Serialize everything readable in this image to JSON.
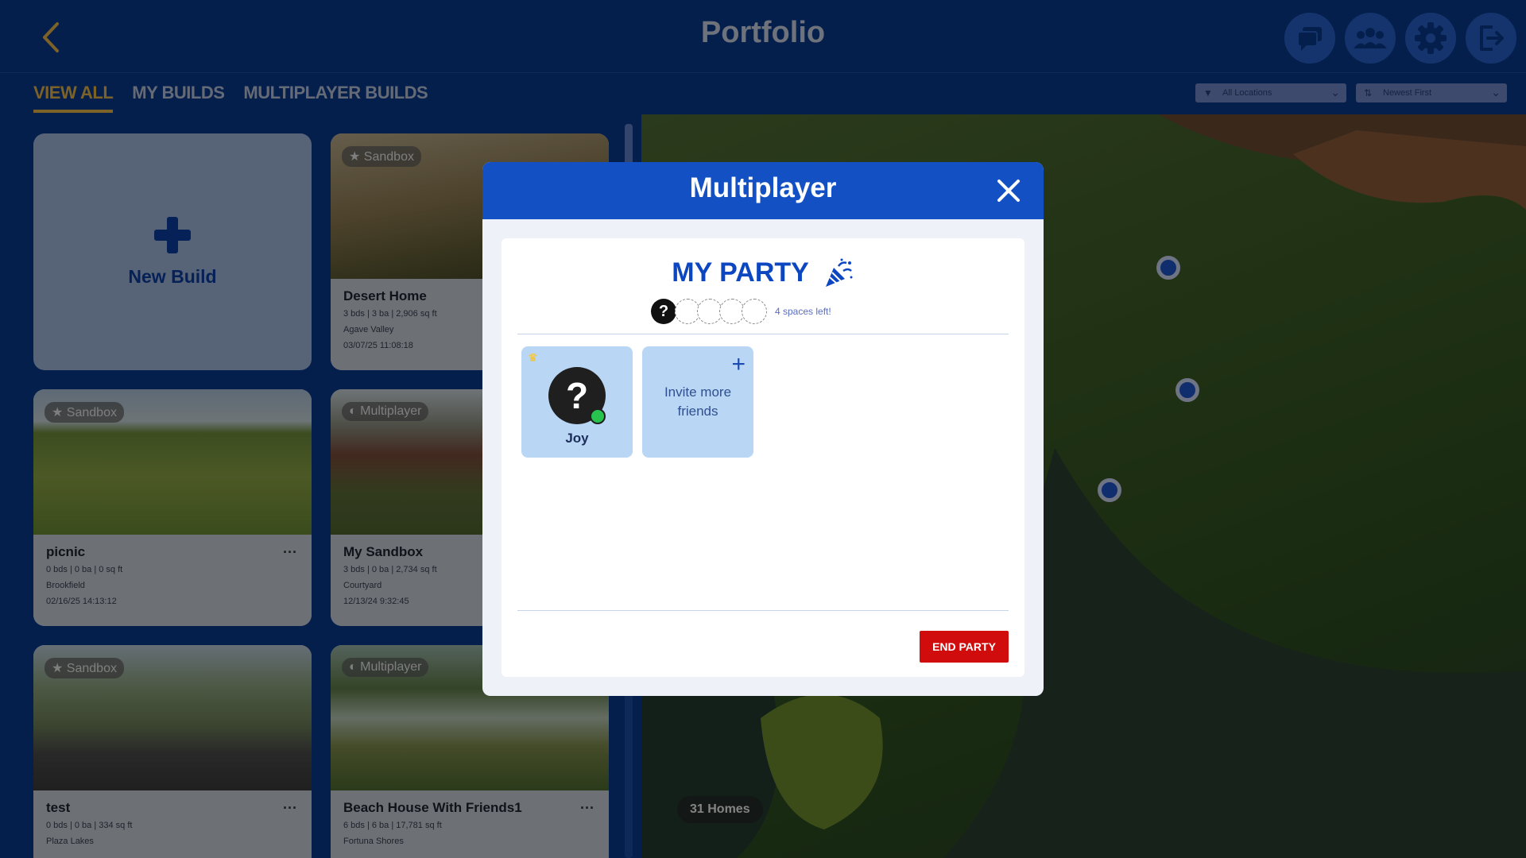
{
  "header": {
    "title": "Portfolio",
    "icons": [
      "back-chevron-icon",
      "chat-icon",
      "friends-icon",
      "settings-gear-icon",
      "logout-icon"
    ]
  },
  "tabs": [
    {
      "label": "VIEW ALL",
      "active": true
    },
    {
      "label": "MY BUILDS",
      "active": false
    },
    {
      "label": "MULTIPLAYER BUILDS",
      "active": false
    }
  ],
  "filters": {
    "location": "All Locations",
    "sort": "Newest First"
  },
  "new_build": {
    "label": "New Build"
  },
  "cards": [
    {
      "badge": "Sandbox",
      "title": "Desert Home",
      "stats": "3 bds | 3 ba | 2,906 sq ft",
      "location": "Agave Valley",
      "date": "03/07/25 11:08:18"
    },
    {
      "badge": "Sandbox",
      "title": "picnic",
      "stats": "0 bds | 0 ba | 0 sq ft",
      "location": "Brookfield",
      "date": "02/16/25 14:13:12"
    },
    {
      "badge": "Multiplayer",
      "title": "My Sandbox",
      "stats": "3 bds | 0 ba | 2,734 sq ft",
      "location": "Courtyard",
      "date": "12/13/24 9:32:45"
    },
    {
      "badge": "Sandbox",
      "title": "test",
      "stats": "0 bds | 0 ba | 334 sq ft",
      "location": "Plaza Lakes",
      "date": ""
    },
    {
      "badge": "Multiplayer",
      "title": "Beach House With Friends1",
      "stats": "6 bds | 6 ba | 17,781 sq ft",
      "location": "Fortuna Shores",
      "date": ""
    }
  ],
  "map": {
    "homes_count": "31 Homes"
  },
  "modal": {
    "title": "Multiplayer",
    "party_title": "MY PARTY",
    "spaces_left": "4 spaces left!",
    "members": [
      {
        "name": "Joy",
        "avatar": "?",
        "online": true,
        "host": true
      }
    ],
    "invite_label_1": "Invite more",
    "invite_label_2": "friends",
    "end_party": "END PARTY"
  },
  "colors": {
    "navy": "#0a3a8c",
    "modal_header": "#1250c4",
    "tab_active": "#e4b24a",
    "end_party": "#d10c0c",
    "online": "#28c24f"
  }
}
